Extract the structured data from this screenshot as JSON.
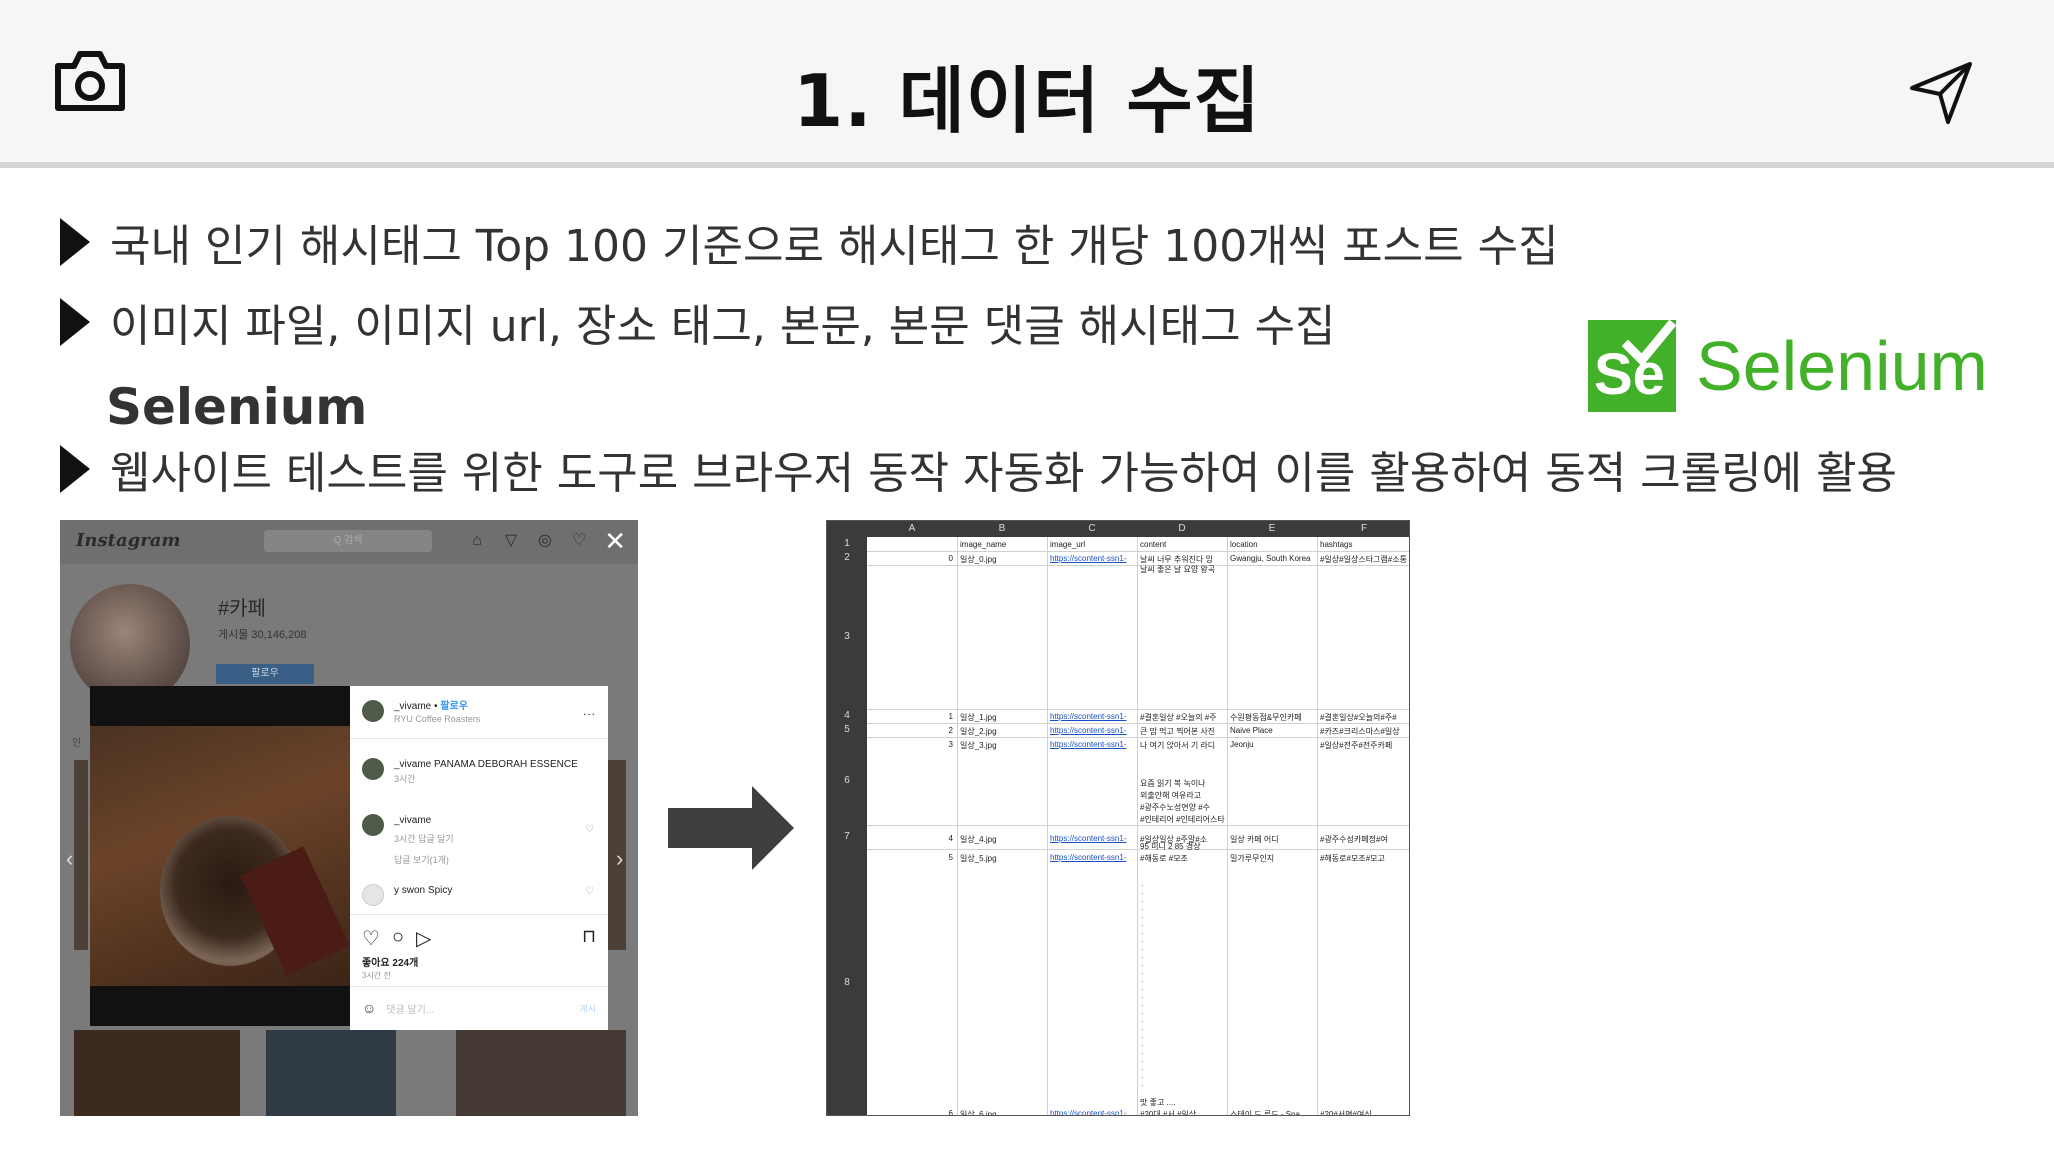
{
  "header": {
    "title": "1. 데이터 수집",
    "left_icon": "camera-icon",
    "right_icon": "send-icon"
  },
  "bullets": [
    "국내 인기 해시태그 Top 100 기준으로 해시태그 한 개당 100개씩 포스트 수집",
    "이미지 파일, 이미지 url, 장소 태그, 본문, 본문 댓글 해시태그 수집",
    "웹사이트 테스트를 위한 도구로 브라우저 동작 자동화 가능하여 이를 활용하여 동적 크롤링에 활용"
  ],
  "selenium": {
    "heading": "Selenium",
    "logo_mark": "Se",
    "logo_text": "Selenium",
    "brand_color": "#43b02a"
  },
  "instagram": {
    "logo": "Instagram",
    "search_placeholder": "Q 검색",
    "hashtag": "#카페",
    "post_count": "게시물 30,146,208",
    "follow_label": "팔로우",
    "side_label": "인",
    "modal": {
      "user": "_vivame",
      "follow_link": "팔로우",
      "location": "RYU Coffee Roasters",
      "more": "...",
      "caption": "_vivame PANAMA DEBORAH ESSENCE",
      "caption_time": "3시간",
      "comment_user": "_vivame",
      "comment_meta": "3시간  답글 달기",
      "view_replies": "답글 보기(1개)",
      "reply": "y swon Spicy",
      "likes": "좋아요 224개",
      "time": "3시간 전",
      "comment_placeholder": "댓글 달기...",
      "post_label": "게시"
    }
  },
  "sheet": {
    "columns": [
      "A",
      "B",
      "C",
      "D",
      "E",
      "F"
    ],
    "headers": [
      "",
      "image_name",
      "image_url",
      "content",
      "location",
      "hashtags"
    ],
    "row_numbers": [
      "1",
      "2",
      "3",
      "4",
      "5",
      "6",
      "7",
      "8"
    ],
    "rows": [
      {
        "idx": "0",
        "image_name": "일상_0.jpg",
        "image_url": "https://scontent-ssn1-",
        "content": "날씨 너무 추워진다 잉",
        "content2": "날씨 좋은 날 요양 왕곡",
        "location": "Gwangju, South Korea",
        "hashtags": "#일상#일상스타그램#소통"
      },
      {
        "idx": "1",
        "image_name": "일상_1.jpg",
        "image_url": "https://scontent-ssn1-",
        "content": "#결혼일상 #오늘의 #주",
        "location": "수원평동점&무인카페",
        "hashtags": "#결혼일상#오늘의#주#"
      },
      {
        "idx": "2",
        "image_name": "일상_2.jpg",
        "image_url": "https://scontent-ssn1-",
        "content": "큰 맘 먹고 찍어본 사진",
        "location": "Naive Place",
        "hashtags": "#카즈#크리스마스#일상"
      },
      {
        "idx": "3",
        "image_name": "일상_3.jpg",
        "image_url": "https://scontent-ssn1-",
        "content": "나 여기 앉아서 기 라디",
        "location": "Jeonju",
        "hashtags": "#일상#전주#전주카페"
      },
      {
        "idx": "4",
        "image_name": "일상_4.jpg",
        "image_url": "https://scontent-ssn1-",
        "content": "#일상일상 #주말#소",
        "content_extra": [
          "요즘 읽기 복 녹이나",
          "외출안해 여유라고",
          "#광주수노성면양 #수",
          "#인테리어 #인테리어스타"
        ],
        "location": "일상 카페 어디",
        "hashtags": "#광주수성카페정#여"
      },
      {
        "idx": "5",
        "image_name": "일상_5.jpg",
        "image_url": "https://scontent-ssn1-",
        "content": "#해동로 #모조",
        "content_extra": [
          "95 미니 2 85 경상"
        ],
        "location": "밀가루무인지",
        "hashtags": "#해동로#모조#모고"
      },
      {
        "idx": "6",
        "image_name": "일상_6.jpg",
        "image_url": "https://scontent-ssn1-",
        "content": "#20대 #서 #일상",
        "content_extra": [
          "맛 좋고 ...."
        ],
        "location": "스테이 드 루드 - Spa",
        "hashtags": "#20#서면#여신"
      }
    ]
  },
  "colors": {
    "header_bg": "#f6f6f6",
    "bullet_marker": "#111111",
    "arrow": "#3f3f3f",
    "sheet_header": "#3b3b3b",
    "link": "#1a4fc4"
  }
}
